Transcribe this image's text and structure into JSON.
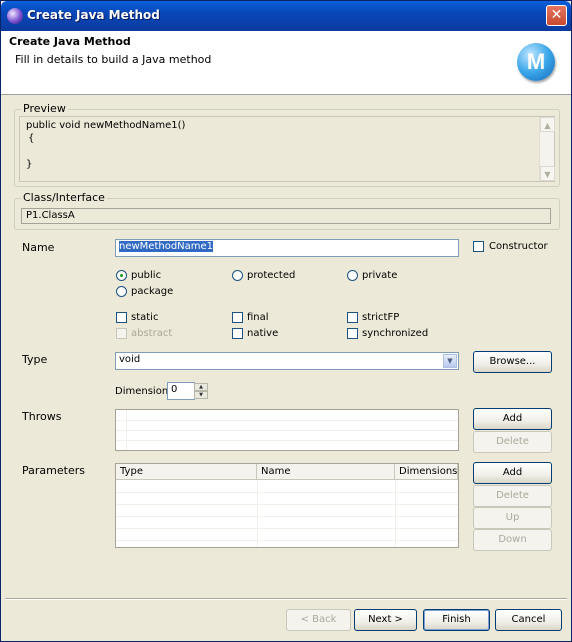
{
  "window": {
    "title": "Create Java Method"
  },
  "header": {
    "title": "Create Java Method",
    "description": "Fill in details to build a Java method",
    "logo_letter": "M"
  },
  "preview": {
    "label": "Preview",
    "lines": [
      "public void newMethodName1()",
      "{",
      "",
      "}"
    ]
  },
  "class_interface": {
    "label": "Class/Interface",
    "value": "P1.ClassA"
  },
  "name": {
    "label": "Name",
    "value": "newMethodName1",
    "constructor_label": "Constructor"
  },
  "visibility": {
    "public": "public",
    "protected": "protected",
    "private": "private",
    "package": "package",
    "selected": "public"
  },
  "modifiers": {
    "static": "static",
    "final": "final",
    "strictfp": "strictFP",
    "abstract": "abstract",
    "native": "native",
    "synchronized": "synchronized"
  },
  "type": {
    "label": "Type",
    "value": "void",
    "browse_label": "Browse..."
  },
  "dimensions": {
    "label": "Dimensions",
    "value": "0"
  },
  "throws": {
    "label": "Throws",
    "add_label": "Add",
    "delete_label": "Delete"
  },
  "parameters": {
    "label": "Parameters",
    "columns": [
      "Type",
      "Name",
      "Dimensions"
    ],
    "add_label": "Add",
    "delete_label": "Delete",
    "up_label": "Up",
    "down_label": "Down"
  },
  "footer": {
    "back_label": "< Back",
    "next_label": "Next >",
    "finish_label": "Finish",
    "cancel_label": "Cancel"
  }
}
